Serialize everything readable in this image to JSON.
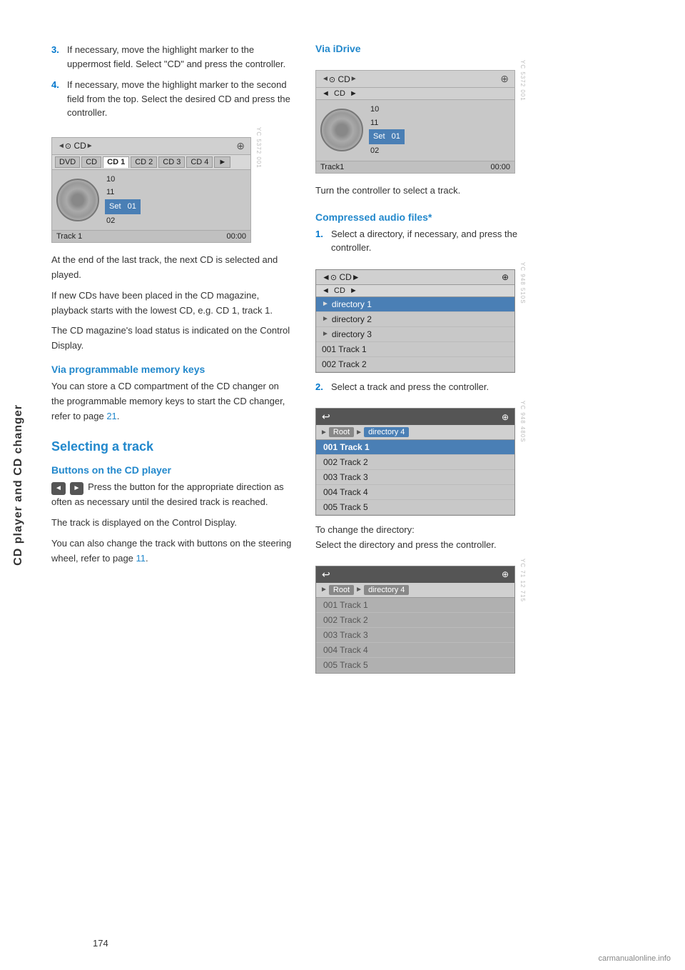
{
  "sidebar": {
    "label": "CD player and CD changer"
  },
  "page_number": "174",
  "left_col": {
    "steps_intro": [
      {
        "num": "3.",
        "text": "If necessary, move the highlight marker to the uppermost field. Select \"CD\" and press the controller."
      },
      {
        "num": "4.",
        "text": "If necessary, move the highlight marker to the second field from the top. Select the desired CD and press the controller."
      }
    ],
    "cd_screen": {
      "top_nav": "◄  CD  ►",
      "settings_icon": "⊕",
      "tabs": [
        "DVD",
        "CD",
        "CD 1",
        "CD 2",
        "CD 3",
        "CD 4",
        "►"
      ],
      "active_tab": "CD 1",
      "tracks": [
        "10",
        "11",
        "Set   01",
        "02"
      ],
      "bottom_left": "Track 1",
      "bottom_right": "00:00"
    },
    "body_texts": [
      "At the end of the last track, the next CD is selected and played.",
      "If new CDs have been placed in the CD magazine, playback starts with the lowest CD, e.g. CD 1, track 1.",
      "The CD magazine's load status is indicated on the Control Display."
    ],
    "via_prog_heading": "Via programmable memory keys",
    "via_prog_text": "You can store a CD compartment of the CD changer on the programmable memory keys to start the CD changer, refer to page 21.",
    "selecting_track_heading": "Selecting a track",
    "buttons_heading": "Buttons on the CD player",
    "buttons_text_pre": "Press the button for the appropriate direction as often as necessary until the desired track is reached.",
    "buttons_text_post": "The track is displayed on the Control Display.",
    "steering_text": "You can also change the track with buttons on the steering wheel, refer to page 11.",
    "page_link_21": "21",
    "page_link_11": "11"
  },
  "right_col": {
    "via_idrive_heading": "Via iDrive",
    "idrive_screen": {
      "top_nav": "◄  CD  ►",
      "second_bar": "◄  CD  ►",
      "tracks": [
        "10",
        "11",
        "Set   01",
        "02"
      ],
      "bottom_left": "Track1",
      "bottom_right": "00:00"
    },
    "turn_controller_text": "Turn the controller to select a track.",
    "compressed_heading": "Compressed audio files*",
    "compressed_steps": [
      {
        "num": "1.",
        "text": "Select a directory, if necessary, and press the controller."
      },
      {
        "num": "2.",
        "text": "Select a track and press the controller."
      }
    ],
    "dir_screen": {
      "top_nav": "◄  CD  ►",
      "settings_icon": "⊕",
      "second_bar": "◄  CD  ►",
      "dirs": [
        {
          "label": "directory 1",
          "selected": true
        },
        {
          "label": "directory 2",
          "selected": false
        },
        {
          "label": "directory 3",
          "selected": false
        },
        {
          "label": "001 Track  1",
          "selected": false
        },
        {
          "label": "002 Track  2",
          "selected": false
        }
      ]
    },
    "track_screen_1": {
      "path": [
        "Root",
        "directory 4"
      ],
      "tracks": [
        {
          "label": "001 Track  1",
          "selected": true
        },
        {
          "label": "002 Track  2",
          "selected": false
        },
        {
          "label": "003 Track  3",
          "selected": false
        },
        {
          "label": "004 Track  4",
          "selected": false
        },
        {
          "label": "005 Track  5",
          "selected": false
        }
      ]
    },
    "change_dir_text": "To change the directory:\nSelect the directory and press the controller.",
    "track_screen_2": {
      "path": [
        "Root",
        "directory 4"
      ],
      "tracks": [
        {
          "label": "001 Track  1",
          "selected": false
        },
        {
          "label": "002 Track  2",
          "selected": false
        },
        {
          "label": "003 Track  3",
          "selected": false
        },
        {
          "label": "004 Track  4",
          "selected": false
        },
        {
          "label": "005 Track  5",
          "selected": false
        }
      ]
    }
  },
  "watermark": "carmanualonline.info"
}
